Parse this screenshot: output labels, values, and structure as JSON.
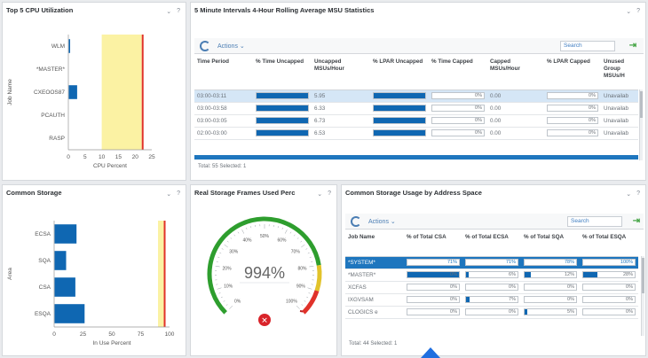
{
  "colors": {
    "accent": "#0f67b2",
    "threshold_yellow": "#fbf2a3",
    "threshold_red": "#e0322a",
    "gauge_green": "#2e9e2e",
    "cursor": "#1f6fe0"
  },
  "cpu_panel": {
    "title": "Top 5 CPU Utilization",
    "controls": [
      "⌄",
      "?"
    ]
  },
  "msu_panel": {
    "title": "5 Minute Intervals 4-Hour Rolling Average MSU Statistics",
    "controls": [
      "⌄",
      "?"
    ],
    "actions_label": "Actions ⌄",
    "search_placeholder": "Search",
    "columns": [
      "Time Period",
      "% Time Uncapped",
      "Uncapped MSUs/Hour",
      "% LPAR Uncapped",
      "% Time Capped",
      "Capped MSUs/Hour",
      "% LPAR Capped",
      "Unused Group MSUs/H"
    ],
    "rows": [
      {
        "time": "03:00-03:11",
        "uncap_pct": 100,
        "msu": "5.95",
        "lpar_pct": 100,
        "cap_pct": "0%",
        "cap_msu": "0.00",
        "lpar_cap": "0%",
        "unused": "Unavailab",
        "sel": "sel"
      },
      {
        "time": "03:00-03:58",
        "uncap_pct": 100,
        "msu": "6.33",
        "lpar_pct": 100,
        "cap_pct": "0%",
        "cap_msu": "0.00",
        "lpar_cap": "0%",
        "unused": "Unavailab",
        "sel": ""
      },
      {
        "time": "03:00-03:05",
        "uncap_pct": 100,
        "msu": "6.73",
        "lpar_pct": 100,
        "cap_pct": "0%",
        "cap_msu": "0.00",
        "lpar_cap": "0%",
        "unused": "Unavailab",
        "sel": ""
      },
      {
        "time": "02:00-03:00",
        "uncap_pct": 100,
        "msu": "6.53",
        "lpar_pct": 100,
        "cap_pct": "0%",
        "cap_msu": "0.00",
        "lpar_cap": "0%",
        "unused": "Unavailab",
        "sel": ""
      }
    ],
    "footer": "Total: 55 Selected: 1"
  },
  "storage_panel": {
    "title": "Common Storage",
    "controls": [
      "⌄",
      "?"
    ]
  },
  "frames_panel": {
    "title": "Real Storage Frames Used Perc",
    "controls": [
      "⌄",
      "?"
    ],
    "value_text": "994%",
    "scale_labels": [
      "0%",
      "10%",
      "20%",
      "30%",
      "40%",
      "50%",
      "60%",
      "70%",
      "80%",
      "90%",
      "100%"
    ]
  },
  "csa_panel": {
    "title": "Common Storage Usage by Address Space",
    "controls": [
      "⌄",
      "?"
    ],
    "actions_label": "Actions ⌄",
    "search_placeholder": "Search",
    "columns": [
      "Job Name",
      "% of Total CSA",
      "% of Total ECSA",
      "% of Total SQA",
      "% of Total ESQA"
    ],
    "rows": [
      {
        "job": "*SYSTEM*",
        "csa": 71,
        "csa_t": "71%",
        "ecsa": 71,
        "ecsa_t": "71%",
        "sqa": 78,
        "sqa_t": "78%",
        "esqa": 100,
        "esqa_t": "100%",
        "sel": "sel2"
      },
      {
        "job": "*MASTER*",
        "csa": 100,
        "csa_t": "0%",
        "ecsa": 6,
        "ecsa_t": "6%",
        "sqa": 12,
        "sqa_t": "12%",
        "esqa": 28,
        "esqa_t": "28%",
        "sel": ""
      },
      {
        "job": "XCFAS",
        "csa": 0,
        "csa_t": "0%",
        "ecsa": 0,
        "ecsa_t": "0%",
        "sqa": 0,
        "sqa_t": "0%",
        "esqa": 0,
        "esqa_t": "0%",
        "sel": ""
      },
      {
        "job": "IXGVSAM",
        "csa": 0,
        "csa_t": "0%",
        "ecsa": 7,
        "ecsa_t": "7%",
        "sqa": 0,
        "sqa_t": "0%",
        "esqa": 0,
        "esqa_t": "0%",
        "sel": ""
      },
      {
        "job": "CLOGICS e",
        "csa": 0,
        "csa_t": "0%",
        "ecsa": 0,
        "ecsa_t": "0%",
        "sqa": 5,
        "sqa_t": "5%",
        "esqa": 0,
        "esqa_t": "0%",
        "sel": ""
      }
    ],
    "footer": "Total: 44 Selected: 1"
  },
  "chart_data": [
    {
      "type": "bar",
      "orientation": "horizontal",
      "title": "Top 5 CPU Utilization",
      "categories": [
        "WLM",
        "*MASTER*",
        "CXEOOS87",
        "PCAUTH",
        "RASP"
      ],
      "values": [
        0.4,
        0,
        2.5,
        0,
        0
      ],
      "xlabel": "CPU Percent",
      "ylabel": "Job Name",
      "xlim": [
        0,
        25
      ],
      "xticks": [
        "0",
        "5",
        "10",
        "15",
        "20",
        "25"
      ],
      "thresholds": {
        "warning_start": 10,
        "critical": 22
      }
    },
    {
      "type": "bar",
      "orientation": "horizontal",
      "title": "Common Storage",
      "categories": [
        "ECSA",
        "SQA",
        "CSA",
        "ESQA"
      ],
      "values": [
        19,
        10,
        18,
        26
      ],
      "xlabel": "In Use Percent",
      "ylabel": "Area",
      "xlim": [
        0,
        100
      ],
      "xticks": [
        "0",
        "25",
        "50",
        "75",
        "100"
      ],
      "thresholds": {
        "warning_start": 90,
        "critical": 95
      }
    },
    {
      "type": "gauge",
      "title": "Real Storage Frames Used Perc",
      "value": 994,
      "range": [
        0,
        100
      ]
    }
  ]
}
